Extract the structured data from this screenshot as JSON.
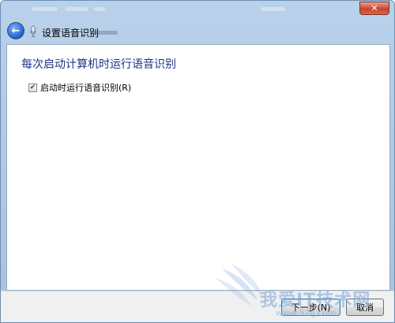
{
  "window": {
    "close_icon": "close-icon"
  },
  "nav": {
    "back_icon": "back-arrow-icon",
    "mic_icon": "microphone-icon",
    "title": "设置语音识别"
  },
  "page": {
    "heading": "每次启动计算机时运行语音识别",
    "option": {
      "label": "启动时运行语音识别(R)",
      "checked": true
    }
  },
  "footer": {
    "next_label": "下一步(N)",
    "cancel_label": "取消"
  },
  "watermark": {
    "text": "我爱IT技术网",
    "url": "www.52ij.com"
  },
  "colors": {
    "heading": "#1e3287",
    "frame": "#b9d1ea",
    "close": "#c7432b"
  }
}
